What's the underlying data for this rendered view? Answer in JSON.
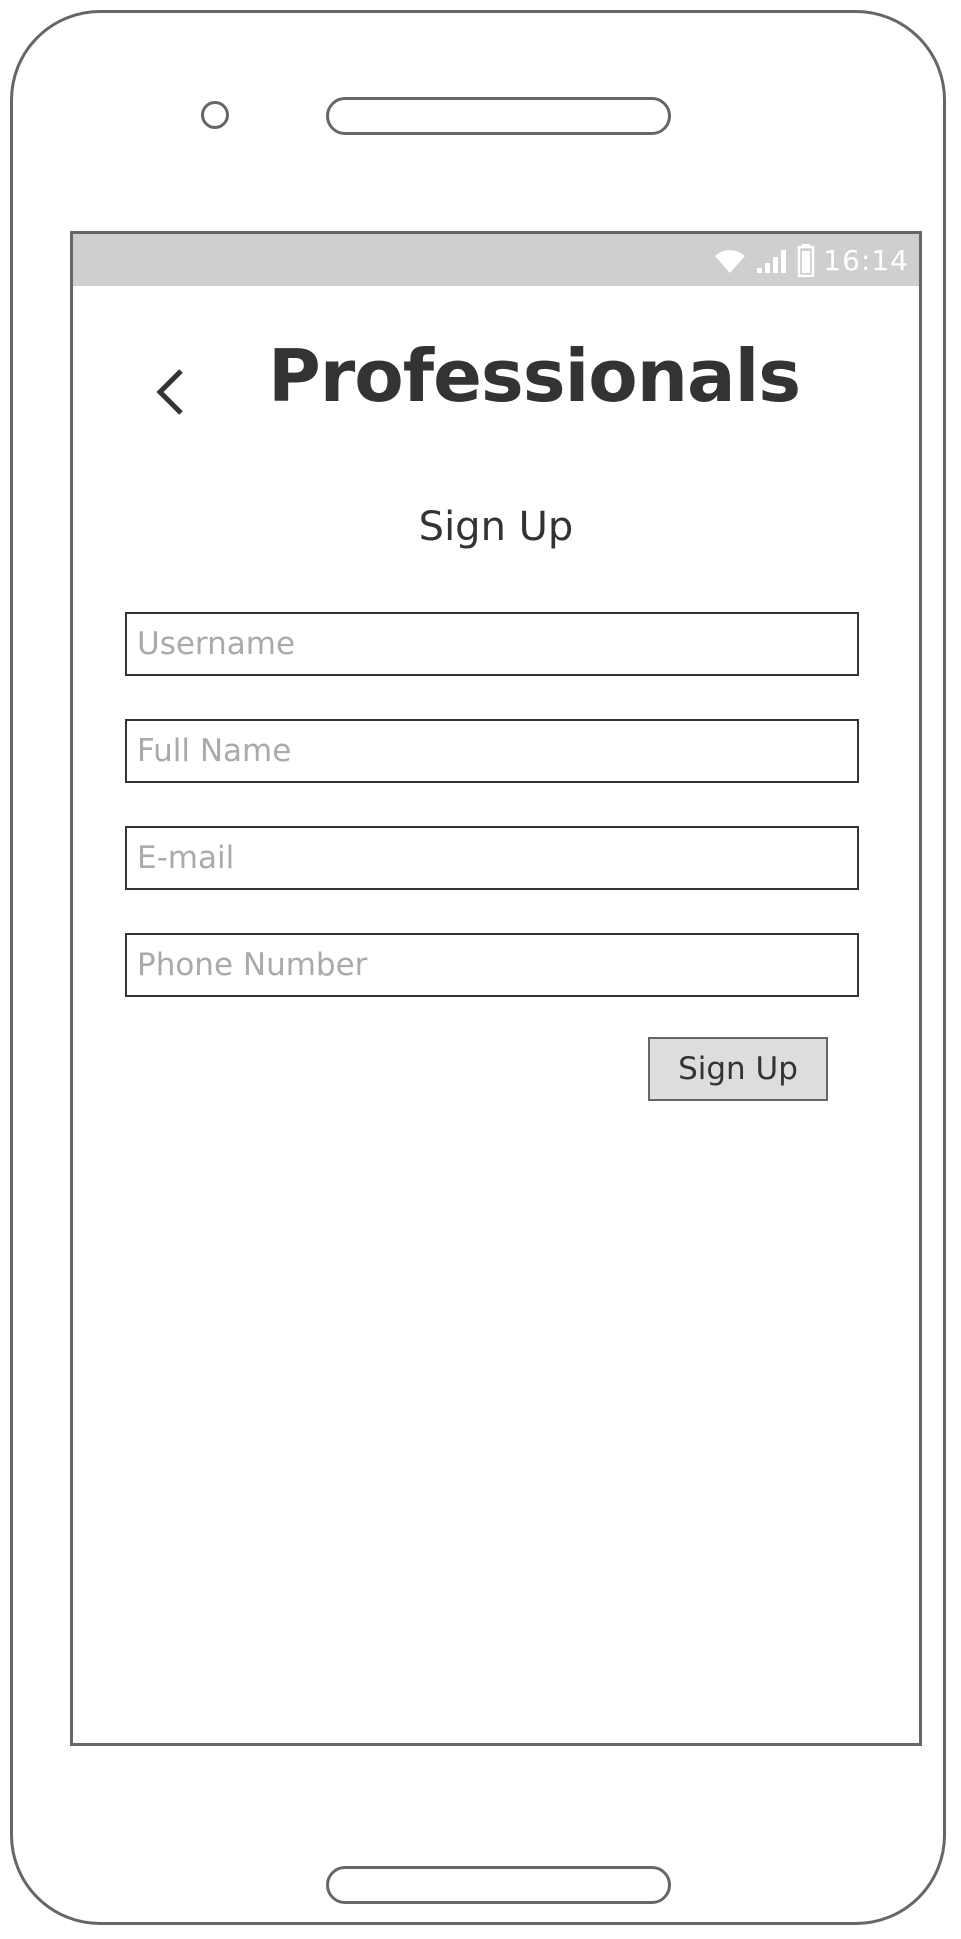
{
  "status_bar": {
    "time": "16:14",
    "icons": [
      "wifi-icon",
      "signal-icon",
      "battery-icon"
    ]
  },
  "header": {
    "back_icon": "chevron-left-icon",
    "title": "Professionals"
  },
  "form": {
    "heading": "Sign Up",
    "fields": {
      "username": {
        "placeholder": "Username",
        "value": ""
      },
      "full_name": {
        "placeholder": "Full Name",
        "value": ""
      },
      "email": {
        "placeholder": "E-mail",
        "value": ""
      },
      "phone": {
        "placeholder": "Phone Number",
        "value": ""
      }
    },
    "submit_label": "Sign Up"
  },
  "colors": {
    "frame": "#666666",
    "status_bar": "#cfcfcf",
    "text": "#333333",
    "placeholder": "#aaaaaa",
    "button_bg": "#dddddd"
  }
}
